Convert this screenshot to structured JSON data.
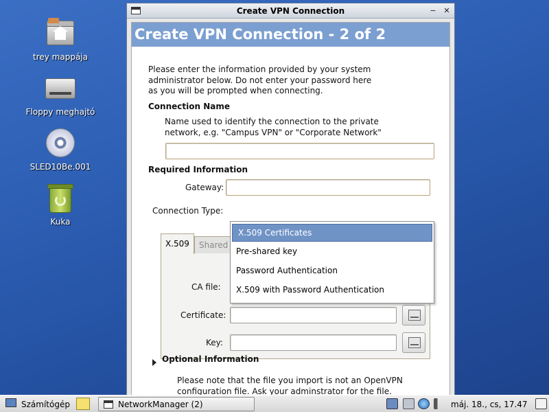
{
  "desktop": {
    "icons": [
      {
        "label": "trey mappája",
        "icon": "home-folder-icon"
      },
      {
        "label": "Floppy meghajtó",
        "icon": "floppy-drive-icon"
      },
      {
        "label": "SLED10Be.001",
        "icon": "cd-icon"
      },
      {
        "label": "Kuka",
        "icon": "trash-icon"
      }
    ]
  },
  "window": {
    "title": "Create VPN Connection",
    "heading": "Create VPN Connection - 2 of 2",
    "intro": "Please enter the information provided by your system administrator below. Do not enter your password here as you will be prompted when connecting.",
    "connection_name": {
      "section_label": "Connection Name",
      "help_text": "Name used to identify the connection to the private network, e.g. \"Campus VPN\" or \"Corporate Network\"",
      "value": ""
    },
    "required": {
      "section_label": "Required Information",
      "gateway_label": "Gateway:",
      "gateway_value": "",
      "connection_type_label": "Connection Type:",
      "connection_type_options": [
        "X.509 Certificates",
        "Pre-shared key",
        "Password Authentication",
        "X.509 with Password Authentication"
      ],
      "connection_type_selected": "X.509 Certificates"
    },
    "tabs": {
      "active": "X.509",
      "inactive": "Shared"
    },
    "x509": {
      "ca_file_label": "CA  file:",
      "certificate_label": "Certificate:",
      "certificate_value": "",
      "key_label": "Key:",
      "key_value": ""
    },
    "optional": {
      "label": "Optional Information",
      "note": "Please note that the file you import is not an OpenVPN configuration file. Ask your adminstrator for the file."
    }
  },
  "taskbar": {
    "menu_label": "Számítógép",
    "task_label": "NetworkManager (2)",
    "clock": "máj. 18., cs, 17.47"
  }
}
